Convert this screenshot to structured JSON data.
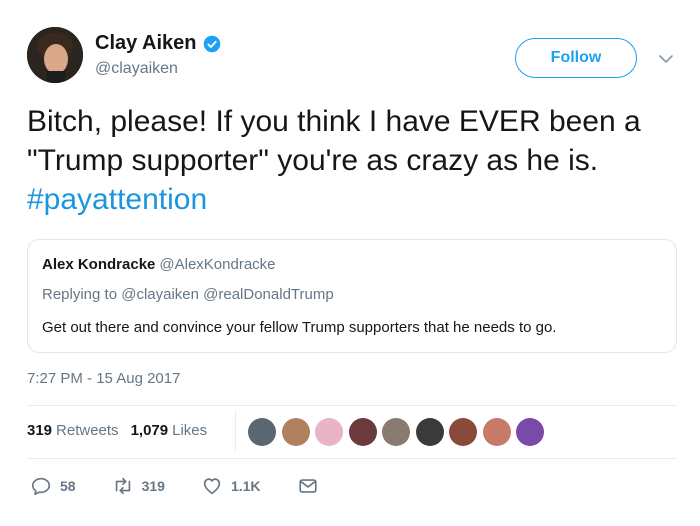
{
  "author": {
    "display_name": "Clay Aiken",
    "handle": "@clayaiken",
    "verified_icon": "verified-badge-icon"
  },
  "follow_button": {
    "label": "Follow"
  },
  "tweet": {
    "text_main": "Bitch, please! If you think I have EVER been a \"Trump supporter\" you're as crazy as he is.",
    "hashtag": "#payattention",
    "timestamp": "7:27 PM - 15 Aug 2017"
  },
  "quoted_tweet": {
    "name": "Alex Kondracke",
    "handle": "@AlexKondracke",
    "replying_to": "Replying to @clayaiken @realDonaldTrump",
    "body": "Get out there and convince your fellow Trump supporters that he needs to go."
  },
  "stats": {
    "retweets_count": "319",
    "retweets_label": "Retweets",
    "likes_count": "1,079",
    "likes_label": "Likes"
  },
  "likers": [
    "#5a6670",
    "#b08060",
    "#e8b4c8",
    "#6b3a3a",
    "#8a7a70",
    "#3a3a3a",
    "#8a4a3a",
    "#c87a6a",
    "#7a4aa8"
  ],
  "actions": {
    "reply_count": "58",
    "retweet_count": "319",
    "like_count": "1.1K"
  },
  "colors": {
    "accent": "#1da1f2",
    "hashtag": "#1b95e0",
    "secondary_text": "#657786"
  }
}
